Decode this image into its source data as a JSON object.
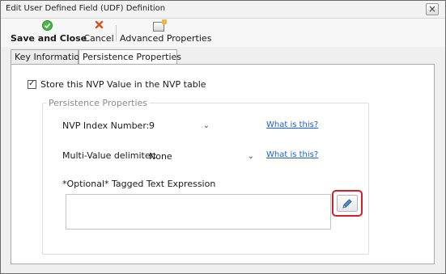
{
  "window": {
    "title": "Edit User Defined Field (UDF) Definition",
    "close_label": "×"
  },
  "toolbar": {
    "save": {
      "icon": "check-circle-icon",
      "label": "Save and Close"
    },
    "cancel": {
      "icon": "x-icon",
      "label": "Cancel"
    },
    "advanced": {
      "icon": "properties-icon",
      "label": "Advanced Properties"
    }
  },
  "tabs": [
    {
      "label": "Key Information",
      "active": false
    },
    {
      "label": "Persistence Properties",
      "active": true
    }
  ],
  "panel": {
    "store_checkbox": {
      "label": "Store this NVP Value in the NVP table",
      "checked": true
    },
    "group_title": "Persistence Properties",
    "nvp_index": {
      "label": "NVP Index Number:",
      "value": "9",
      "help": "What is this?"
    },
    "multi_value": {
      "label": "Multi-Value delimiter:",
      "value": "None",
      "help": "What is this?"
    },
    "tagged_text": {
      "label": "*Optional* Tagged Text Expression",
      "value": ""
    },
    "edit_button": {
      "icon": "pencil-icon",
      "highlight_color": "#d0202a"
    }
  },
  "colors": {
    "link": "#1f5fcc",
    "save_icon": "#3aa23a",
    "cancel_icon": "#d4511e"
  }
}
